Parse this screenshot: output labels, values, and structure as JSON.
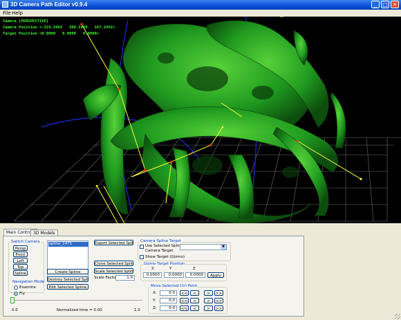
{
  "window": {
    "title": "3D Camera Path Editor v0.9.4",
    "minimize_glyph": "_",
    "maximize_glyph": "□",
    "close_glyph": "×"
  },
  "menu": {
    "file": "File",
    "help": "Help"
  },
  "viewport": {
    "camera_mode": "Camera [PERSPECTIVE]",
    "camera_position": "Camera Position <-224.2983   306.5689   167.2452>",
    "target_position": "Target Position <0.0000   0.0000   0.0000>"
  },
  "tabs": [
    {
      "label": "Main Controls",
      "active": true
    },
    {
      "label": "3D Models",
      "active": false
    }
  ],
  "switch_camera": {
    "label": "Switch Camera",
    "buttons": [
      "Persp",
      "Front",
      "Left",
      "Top",
      "Spline"
    ]
  },
  "navigation_mode": {
    "label": "Navigation Mode",
    "options": [
      {
        "label": "Examine",
        "selected": false
      },
      {
        "label": "Fly",
        "selected": true
      }
    ]
  },
  "spline_list": {
    "items": [
      "spline_1471"
    ]
  },
  "spline_buttons": {
    "create": "Create Spline",
    "destroy": "Destroy Selected Spline",
    "edit": "Edit Selected Spline",
    "export": "Export Selected Spline",
    "clone": "Clone Selected Spline",
    "scale": "Scale Selected Spline",
    "scale_factor_label": "Scale Factor:",
    "scale_factor_value": "1.0"
  },
  "camera_spline_target": {
    "label": "Camera Spline Target",
    "use_selected_line1": "Use Selected Spline As",
    "use_selected_line2": "Camera Target",
    "use_selected_checked": false,
    "show_target": "Show Target (Gizmo)",
    "show_target_checked": false,
    "combo_arrow": "▼"
  },
  "gizmo_target": {
    "label": "Gizmo Target Position",
    "x_label": "X",
    "y_label": "Y",
    "z_label": "Z",
    "x": "0.0000",
    "y": "0.0000",
    "z": "0.0000",
    "apply": "Apply"
  },
  "move_ctrl_point": {
    "label": "Move Selected Ctrl Point",
    "rows": [
      {
        "axis": "X:",
        "value": "0.0"
      },
      {
        "axis": "Y:",
        "value": "0.0"
      },
      {
        "axis": "Z:",
        "value": "0.0"
      }
    ],
    "step_buttons": [
      "<<",
      "<",
      ">",
      ">>"
    ]
  },
  "timeline": {
    "min_label": "0.0",
    "max_label": "1.0",
    "normalized_time": "Normalized time = 0.00",
    "value": 0.0
  },
  "colors": {
    "overlay_text": "#3cff2c",
    "model_green": "#1f9a1f",
    "spline_blue": "#1a2be0",
    "spline_yellow": "#ffff3c",
    "grid": "#8a8a8a"
  }
}
